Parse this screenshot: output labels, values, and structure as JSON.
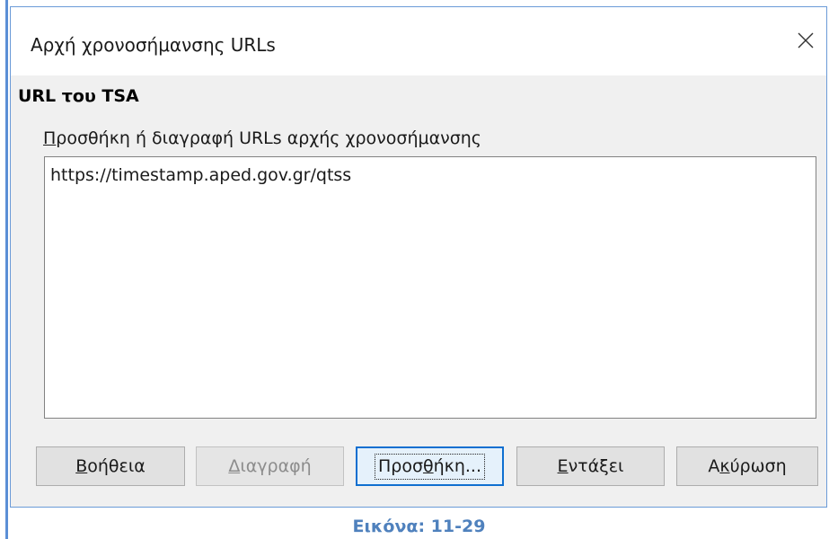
{
  "dialog": {
    "title": "Αρχή χρονοσήμανσης URLs",
    "close_icon": "close-icon"
  },
  "section": {
    "title": "URL του TSA",
    "list_label_mnemonic": "Π",
    "list_label_rest": "ροσθήκη ή διαγραφή URLs αρχής χρονοσήμανσης"
  },
  "url_list": {
    "items": [
      "https://timestamp.aped.gov.gr/qtss"
    ]
  },
  "buttons": {
    "help": {
      "mnemonic": "Β",
      "rest": "οήθεια"
    },
    "delete": {
      "mnemonic": "Δ",
      "rest": "ιαγραφή",
      "enabled": false
    },
    "add": {
      "before": "Προσ",
      "mnemonic": "θ",
      "after": "ήκη...",
      "focused": true
    },
    "ok": {
      "mnemonic": "Ε",
      "rest": "ντάξει"
    },
    "cancel": {
      "before": "Α",
      "mnemonic": "κ",
      "after": "ύρωση"
    }
  },
  "caption": "Εικόνα: 11-29",
  "colors": {
    "accent": "#0f6fd0",
    "caption": "#4f81bd",
    "dialog_border": "#6b9bd8"
  }
}
